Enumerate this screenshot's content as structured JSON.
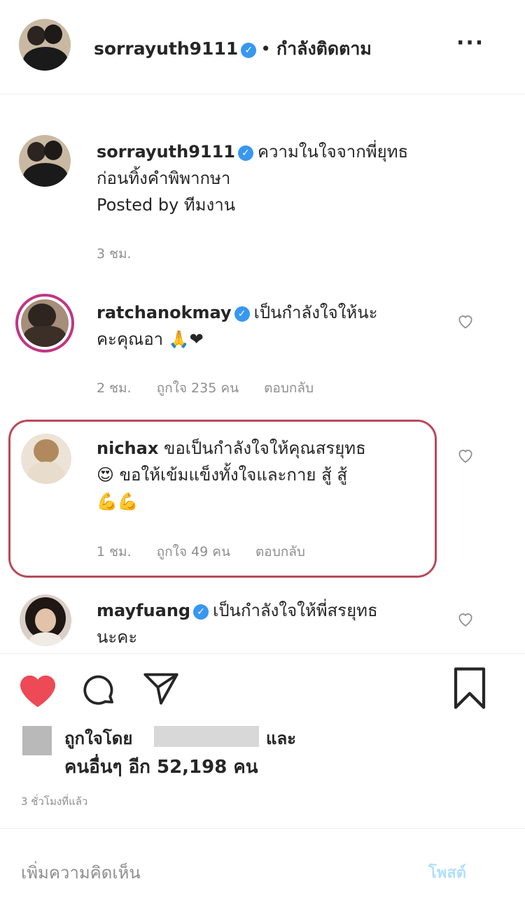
{
  "header": {
    "username": "sorrayuth9111",
    "separator": "•",
    "follow_status": "กำลังติดตาม",
    "more_label": "···"
  },
  "caption": {
    "username": "sorrayuth9111",
    "text_line1": "ความในใจจากพี่ยุทธ",
    "text_line2": "ก่อนทิ้งคำพิพากษา",
    "text_line3": "Posted by ทีมงาน",
    "time": "3 ชม."
  },
  "comments": [
    {
      "username": "ratchanokmay",
      "verified": true,
      "text_line1": "เป็นกำลังใจให้นะ",
      "text_line2": "คะคุณอา 🙏❤",
      "time": "2 ชม.",
      "likes": "ถูกใจ 235 คน",
      "reply": "ตอบกลับ"
    },
    {
      "username": "nichax",
      "verified": false,
      "text_line1": "ขอเป็นกำลังใจให้คุณสรยุทธ",
      "text_line2": "😍 ขอให้เข้มแข็งทั้งใจและกาย สู้ สู้",
      "text_line3": "💪💪",
      "time": "1 ชม.",
      "likes": "ถูกใจ 49 คน",
      "reply": "ตอบกลับ",
      "highlighted": true
    },
    {
      "username": "mayfuang",
      "verified": true,
      "text_line1": "เป็นกำลังใจให้พี่สรยุทธ",
      "text_line2": "นะคะ"
    }
  ],
  "actions": {
    "like_icon": "heart-icon",
    "comment_icon": "comment-icon",
    "share_icon": "paper-plane-icon",
    "save_icon": "bookmark-icon"
  },
  "likes": {
    "prefix": "ถูกใจโดย",
    "and": "และ",
    "others": "คนอื่นๆ อีก 52,198 คน"
  },
  "post_time": "3 ชั่วโมงที่แล้ว",
  "comment_input": {
    "placeholder": "เพิ่มความคิดเห็น",
    "post_label": "โพสต์"
  },
  "colors": {
    "verified": "#3897f0",
    "like_red": "#ed4956",
    "highlight_border": "#b84a5a",
    "post_link": "#b2dffc"
  }
}
